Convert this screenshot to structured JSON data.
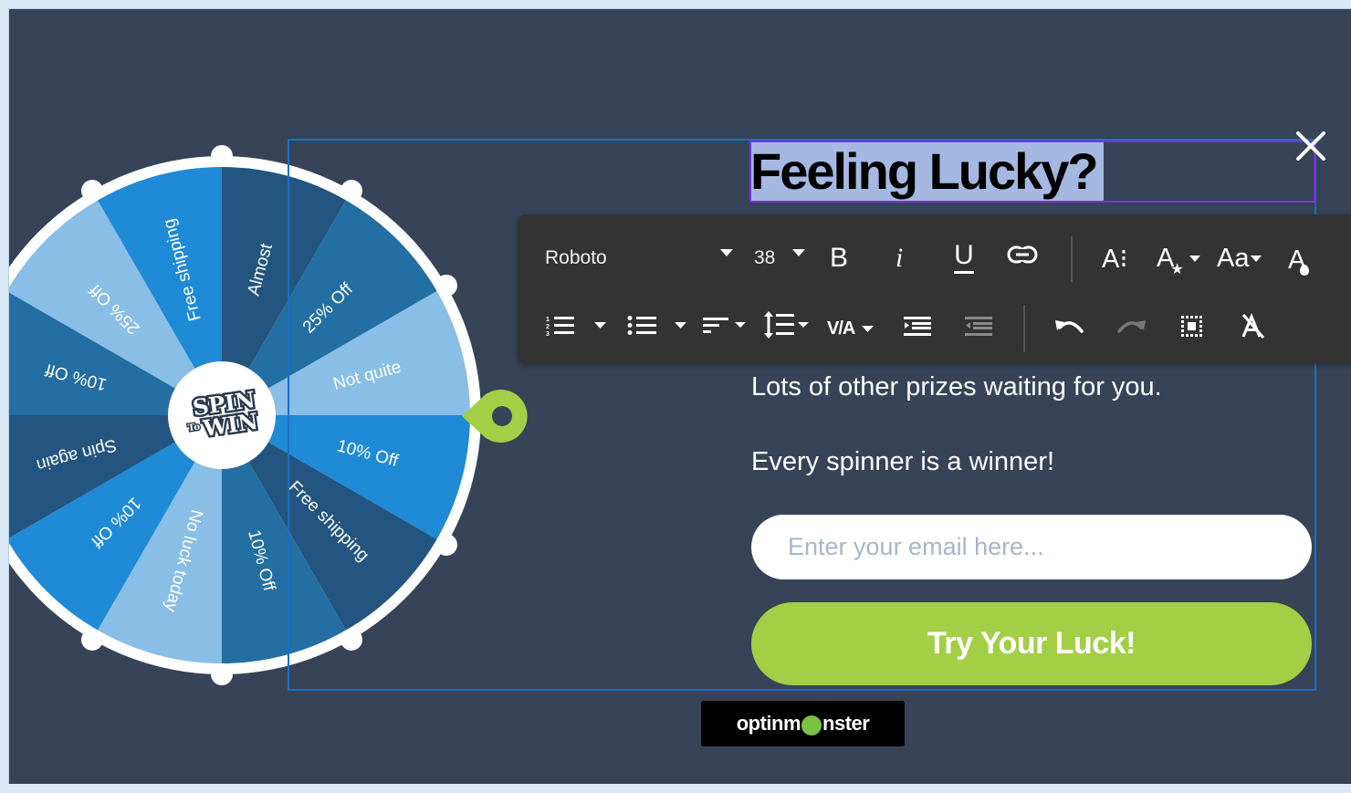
{
  "colors": {
    "page_bg": "#dce9f6",
    "canvas_bg": "#374357",
    "selection_frame": "#1b6fc7",
    "heading_frame": "#7b2ee0",
    "text_highlight": "#a4b8e2",
    "toolbar_bg": "#333333",
    "accent_green": "#a2cf45",
    "wheel_dark": "#235580",
    "wheel_medium": "#236ea2",
    "wheel_light": "#89bee6",
    "wheel_bright": "#1f8ad6",
    "wheel_rim": "#ffffff"
  },
  "wheel": {
    "hub_label_top": "SPIN",
    "hub_label_mid": "To",
    "hub_label_bottom": "WIN",
    "segments": [
      {
        "label": "Almost",
        "shade": "dark"
      },
      {
        "label": "25% Off",
        "shade": "medium"
      },
      {
        "label": "Not quite",
        "shade": "light"
      },
      {
        "label": "10% Off",
        "shade": "bright"
      },
      {
        "label": "Free shipping",
        "shade": "dark"
      },
      {
        "label": "10% Off",
        "shade": "medium"
      },
      {
        "label": "No luck today",
        "shade": "light"
      },
      {
        "label": "10% Off",
        "shade": "bright"
      },
      {
        "label": "Spin again",
        "shade": "dark"
      },
      {
        "label": "10% Off",
        "shade": "medium"
      },
      {
        "label": "25% Off",
        "shade": "light"
      },
      {
        "label": "Free shipping",
        "shade": "bright"
      }
    ],
    "pointer_icon": "map-pin-pointer"
  },
  "popup": {
    "heading": "Feeling Lucky?",
    "body_line_1": "Lots of other prizes waiting for you.",
    "body_line_2": "Every spinner is a winner!",
    "email_placeholder": "Enter your email here...",
    "email_value": "",
    "cta_label": "Try Your Luck!",
    "close_icon": "close-x",
    "branding_pre": "optinm",
    "branding_post": "nster"
  },
  "toolbar": {
    "font_family": "Roboto",
    "font_size": "38",
    "row1": [
      "bold",
      "italic",
      "underline",
      "link",
      "text-spacing",
      "text-effects",
      "text-case",
      "text-color"
    ],
    "row2": [
      "ordered-list",
      "unordered-list",
      "align",
      "line-height",
      "letter-spacing",
      "indent",
      "outdent",
      "undo",
      "redo",
      "select-all",
      "clear-formatting"
    ],
    "bold_label": "B",
    "italic_label": "i",
    "underline_label": "U",
    "case_label": "Aa",
    "spacing_label": "V/A"
  }
}
